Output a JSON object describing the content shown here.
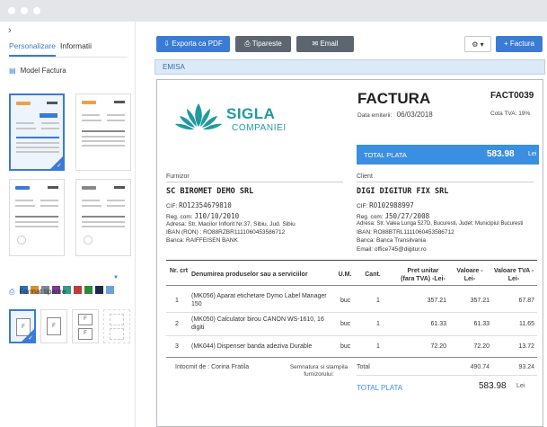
{
  "left": {
    "tabs": [
      "Personalizare",
      "Informatii"
    ],
    "model_title": "Model Factura",
    "format_title": "Format tiparire",
    "format_letters": [
      "F",
      "F",
      "F",
      ""
    ],
    "swatches": [
      "#2d6fb5",
      "#e08a2c",
      "#7a8a99",
      "#7a3a9a",
      "#2e9e8a",
      "#c03a3a",
      "#2e8a3a",
      "#1b2a4a",
      "#6aa2dd"
    ]
  },
  "toolbar": {
    "export_pdf": "Exporta ca PDF",
    "print": "Tipareste",
    "email": "Email",
    "settings": "⚙ ▾",
    "new_invoice": "+ Factura"
  },
  "emisa": "EMISA",
  "invoice": {
    "logo_line1": "SIGLA",
    "logo_line2": "COMPANIEI",
    "title": "FACTURA",
    "number": "FACT0039",
    "date_label": "Data emiterii:",
    "date_value": "06/03/2018",
    "vat_rate": "Cota TVA: 19%",
    "total_label": "TOTAL PLATA",
    "total_value": "583.98",
    "currency": "Lei",
    "supplier": {
      "label": "Furnizor",
      "name": "SC BIROMET DEMO SRL",
      "cif_label": "CIF:",
      "cif": "RO12354679810",
      "reg_label": "Reg. com:",
      "reg": "J10/10/2010",
      "address": "Adresa: Str. Macilor Inflorit Nr.37, Sibiu, Jud. Sibiu",
      "iban": "IBAN (RON) : RO88RZBR1111060453586712",
      "bank": "Banca: RAIFFEISEN BANK"
    },
    "client": {
      "label": "Client",
      "name": "DIGI DIGITUR FIX SRL",
      "cif_label": "CIF:",
      "cif": "RO102988997",
      "reg_label": "Reg. com:",
      "reg": "J50/27/2008",
      "address": "Adresa: Str. Valea Lunga 527D, Bucuresti, Judet: Municipiul Bucuresti",
      "iban": "IBAN: RO88BTRL1111060453586712",
      "bank": "Banca: Banca Transilvania",
      "email": "Email: office745@digitur.ro"
    },
    "table": {
      "headers": [
        "Nr. crt",
        "Denumirea produselor sau a serviciilor",
        "U.M.",
        "Cant.",
        "Pret unitar (fara TVA) -Lei-",
        "Valoare -Lei-",
        "Valoare TVA -Lei-"
      ],
      "rows": [
        {
          "nr": "1",
          "name": "(MK056) Aparat etichetare Dymo Label Manager 150",
          "um": "buc",
          "qty": "1",
          "price": "357.21",
          "value": "357.21",
          "vat": "67.87"
        },
        {
          "nr": "2",
          "name": "(MK050) Calculator birou CANON WS-1610, 16 digiti",
          "um": "buc",
          "qty": "1",
          "price": "61.33",
          "value": "61.33",
          "vat": "11.65"
        },
        {
          "nr": "3",
          "name": "(MK044) Dispenser banda adeziva Durable",
          "um": "buc",
          "qty": "1",
          "price": "72.20",
          "value": "72.20",
          "vat": "13.72"
        }
      ]
    },
    "footer": {
      "issued_by": "Intocmit de : Corina Fratila",
      "signature": "Semnatura si stampila furnizorului:",
      "total_label": "Total",
      "total_value": "490.74",
      "total_vat": "93.24",
      "grand_label": "TOTAL PLATA",
      "grand_value": "583.98",
      "grand_currency": "Lei"
    }
  }
}
